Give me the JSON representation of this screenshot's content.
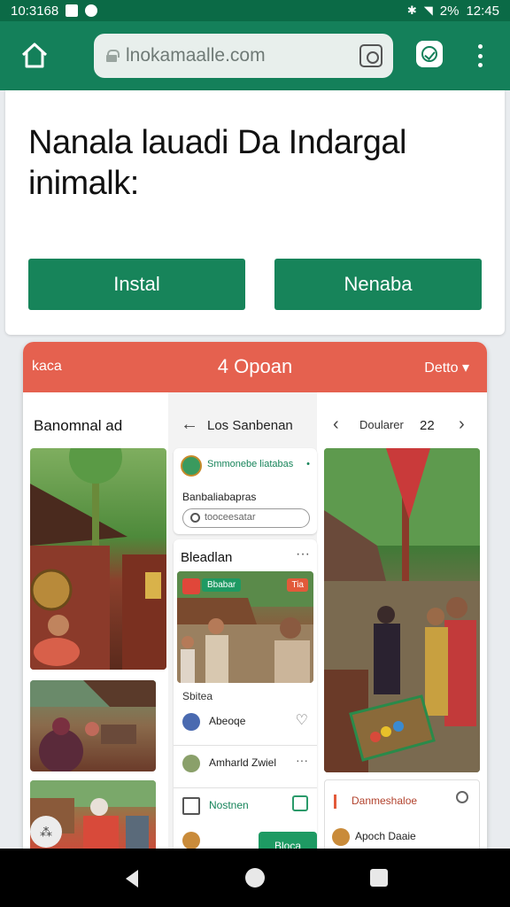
{
  "status_bar": {
    "left_time": "10:3168",
    "right_battery": "2%",
    "right_time": "12:45"
  },
  "app_bar": {
    "url": "lnokamaalle.com"
  },
  "hero": {
    "heading_line1": "Nanala lauadi Da Indargal",
    "heading_line2": "inimalk:",
    "button_primary": "Instal",
    "button_secondary": "Nenaba"
  },
  "preview": {
    "header_left": "kaca",
    "header_center": "4 Opoan",
    "header_right": "Detto ▾",
    "left_column_title": "Banomnal ad",
    "nav_title": "Los Sanbenan",
    "nav_label": "Doularer",
    "nav_number": "22",
    "search_card": {
      "app_name": "Smmonebe liatabas",
      "label": "Banbaliabapras",
      "input_placeholder": "tooceesatar"
    },
    "feed_card": {
      "title": "Bleadlan",
      "badge_green": "Bbabar",
      "badge_red": "Tia",
      "subtitle": "Sbitea",
      "row1_text": "Abeoqe",
      "row2_text": "Amharld Zwiel",
      "row3_text": "Nostnen",
      "fab_label": "Bloca"
    },
    "bottom_card": {
      "title": "Danmeshaloe",
      "text": "Apoch Daaie"
    }
  },
  "colors": {
    "primary_green": "#17845a",
    "app_bar": "#14805a",
    "accent_red": "#e5614f"
  }
}
